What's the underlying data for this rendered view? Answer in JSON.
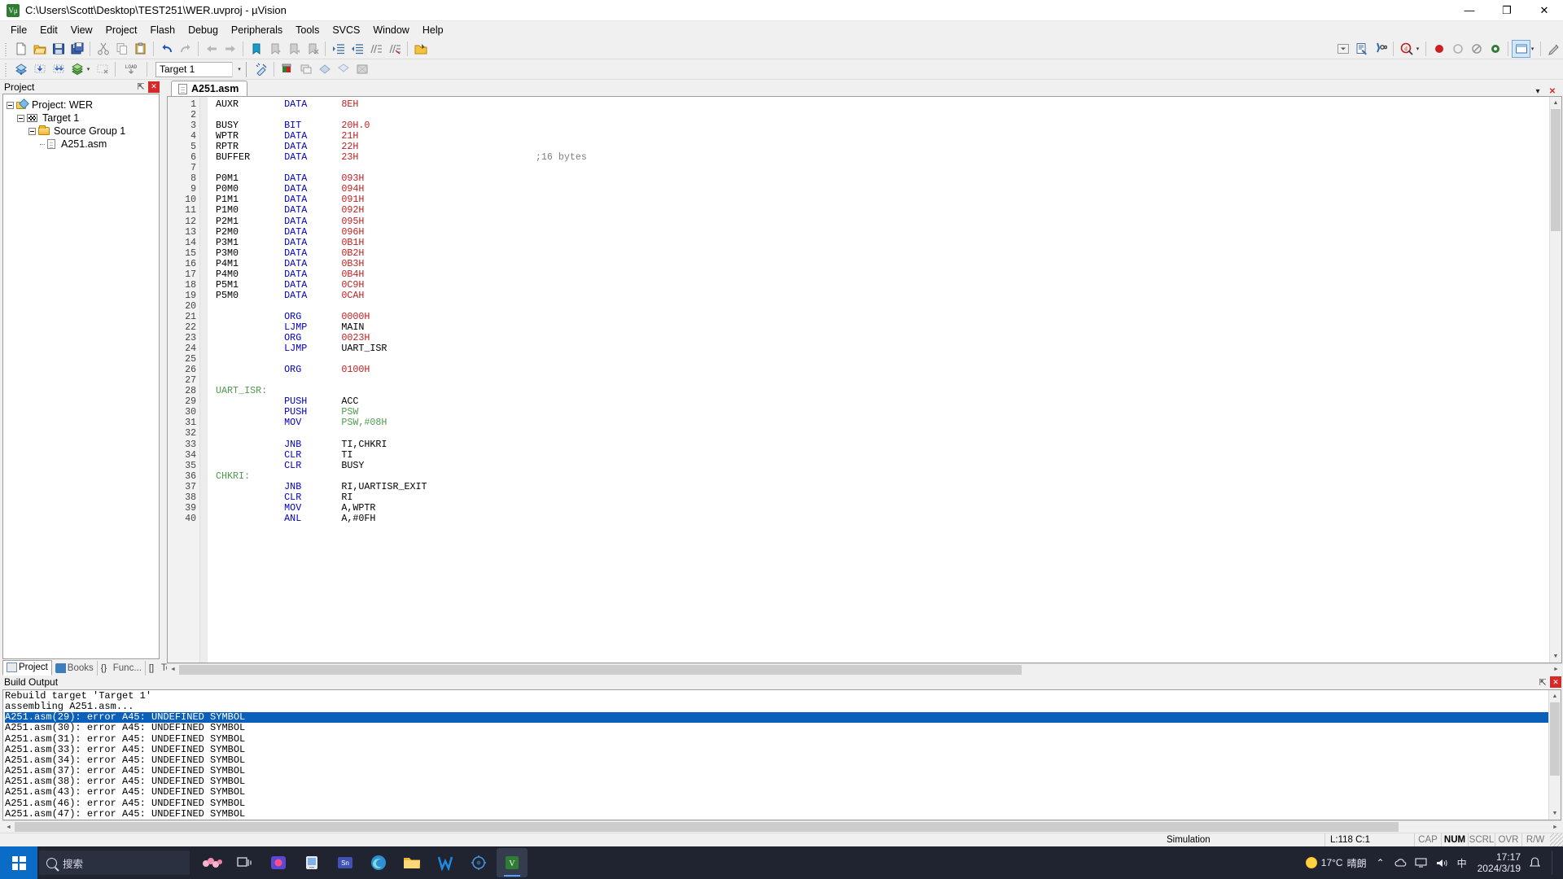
{
  "window": {
    "title": "C:\\Users\\Scott\\Desktop\\TEST251\\WER.uvproj - µVision",
    "app_icon": "uvision-icon",
    "minimize": "—",
    "maximize": "❐",
    "close": "✕"
  },
  "menu": {
    "items": [
      "File",
      "Edit",
      "View",
      "Project",
      "Flash",
      "Debug",
      "Peripherals",
      "Tools",
      "SVCS",
      "Window",
      "Help"
    ]
  },
  "toolbar_main": {
    "buttons": [
      "new-file",
      "open-file",
      "save",
      "save-all",
      "cut",
      "copy",
      "paste",
      "undo",
      "redo",
      "navigate-back",
      "navigate-forward",
      "insert-bookmark",
      "previous-bookmark",
      "next-bookmark",
      "clear-bookmarks",
      "indent",
      "outdent",
      "comment-block",
      "uncomment-block",
      "open-project-folder"
    ],
    "combo_value": "",
    "right_buttons": [
      "code-completion",
      "configure-target",
      "find-in-files"
    ],
    "debug_buttons": [
      "start-debug-session",
      "insert-breakpoint",
      "kill-breakpoints",
      "disable-breakpoint",
      "window-layout",
      "configuration-wizard"
    ],
    "zoom_dropdown": "▾"
  },
  "toolbar_build": {
    "buttons": [
      "translate",
      "build",
      "rebuild",
      "batch-build",
      "stop-build",
      "download"
    ],
    "target_label": "Target 1",
    "target_dropdown": "▾",
    "after_buttons": [
      "target-options",
      "manage-project-items",
      "manage-run-time-env",
      "remove-item",
      "multi-project"
    ]
  },
  "project_panel": {
    "caption": "Project",
    "pin": "⇱",
    "close": "✕",
    "tree": [
      {
        "label": "Project: WER",
        "icon": "project-icon",
        "level": 0,
        "expanded": true
      },
      {
        "label": "Target 1",
        "icon": "target-icon",
        "level": 1,
        "expanded": true
      },
      {
        "label": "Source Group 1",
        "icon": "folder-icon",
        "level": 2,
        "expanded": true
      },
      {
        "label": "A251.asm",
        "icon": "file-icon",
        "level": 3,
        "expanded": false
      }
    ],
    "tabs": [
      {
        "label": "Project",
        "icon": "project-tab-icon",
        "active": true
      },
      {
        "label": "Books",
        "icon": "books-tab-icon",
        "active": false
      },
      {
        "label": "Func...",
        "icon": "functions-tab-icon",
        "active": false
      },
      {
        "label": "Temp...",
        "icon": "templates-tab-icon",
        "active": false
      }
    ]
  },
  "editor": {
    "tab_label": "A251.asm",
    "tab_icon": "source-file-icon",
    "restore_icon": "▾",
    "close_icon": "✕",
    "first_line_number": 1,
    "lines": [
      {
        "n": 1,
        "tokens": [
          {
            "t": "AUXR",
            "c": "pln",
            "col": 0
          },
          {
            "t": "DATA",
            "c": "kw",
            "col": 12
          },
          {
            "t": "8EH",
            "c": "num",
            "col": 22
          }
        ]
      },
      {
        "n": 2,
        "tokens": []
      },
      {
        "n": 3,
        "tokens": [
          {
            "t": "BUSY",
            "c": "pln",
            "col": 0
          },
          {
            "t": "BIT",
            "c": "kw",
            "col": 12
          },
          {
            "t": "20H.0",
            "c": "num",
            "col": 22
          }
        ]
      },
      {
        "n": 4,
        "tokens": [
          {
            "t": "WPTR",
            "c": "pln",
            "col": 0
          },
          {
            "t": "DATA",
            "c": "kw",
            "col": 12
          },
          {
            "t": "21H",
            "c": "num",
            "col": 22
          }
        ]
      },
      {
        "n": 5,
        "tokens": [
          {
            "t": "RPTR",
            "c": "pln",
            "col": 0
          },
          {
            "t": "DATA",
            "c": "kw",
            "col": 12
          },
          {
            "t": "22H",
            "c": "num",
            "col": 22
          }
        ]
      },
      {
        "n": 6,
        "tokens": [
          {
            "t": "BUFFER",
            "c": "pln",
            "col": 0
          },
          {
            "t": "DATA",
            "c": "kw",
            "col": 12
          },
          {
            "t": "23H",
            "c": "num",
            "col": 22
          },
          {
            "t": ";16 bytes",
            "c": "cmt",
            "col": 56
          }
        ]
      },
      {
        "n": 7,
        "tokens": []
      },
      {
        "n": 8,
        "tokens": [
          {
            "t": "P0M1",
            "c": "pln",
            "col": 0
          },
          {
            "t": "DATA",
            "c": "kw",
            "col": 12
          },
          {
            "t": "093H",
            "c": "num",
            "col": 22
          }
        ]
      },
      {
        "n": 9,
        "tokens": [
          {
            "t": "P0M0",
            "c": "pln",
            "col": 0
          },
          {
            "t": "DATA",
            "c": "kw",
            "col": 12
          },
          {
            "t": "094H",
            "c": "num",
            "col": 22
          }
        ]
      },
      {
        "n": 10,
        "tokens": [
          {
            "t": "P1M1",
            "c": "pln",
            "col": 0
          },
          {
            "t": "DATA",
            "c": "kw",
            "col": 12
          },
          {
            "t": "091H",
            "c": "num",
            "col": 22
          }
        ]
      },
      {
        "n": 11,
        "tokens": [
          {
            "t": "P1M0",
            "c": "pln",
            "col": 0
          },
          {
            "t": "DATA",
            "c": "kw",
            "col": 12
          },
          {
            "t": "092H",
            "c": "num",
            "col": 22
          }
        ]
      },
      {
        "n": 12,
        "tokens": [
          {
            "t": "P2M1",
            "c": "pln",
            "col": 0
          },
          {
            "t": "DATA",
            "c": "kw",
            "col": 12
          },
          {
            "t": "095H",
            "c": "num",
            "col": 22
          }
        ]
      },
      {
        "n": 13,
        "tokens": [
          {
            "t": "P2M0",
            "c": "pln",
            "col": 0
          },
          {
            "t": "DATA",
            "c": "kw",
            "col": 12
          },
          {
            "t": "096H",
            "c": "num",
            "col": 22
          }
        ]
      },
      {
        "n": 14,
        "tokens": [
          {
            "t": "P3M1",
            "c": "pln",
            "col": 0
          },
          {
            "t": "DATA",
            "c": "kw",
            "col": 12
          },
          {
            "t": "0B1H",
            "c": "num",
            "col": 22
          }
        ]
      },
      {
        "n": 15,
        "tokens": [
          {
            "t": "P3M0",
            "c": "pln",
            "col": 0
          },
          {
            "t": "DATA",
            "c": "kw",
            "col": 12
          },
          {
            "t": "0B2H",
            "c": "num",
            "col": 22
          }
        ]
      },
      {
        "n": 16,
        "tokens": [
          {
            "t": "P4M1",
            "c": "pln",
            "col": 0
          },
          {
            "t": "DATA",
            "c": "kw",
            "col": 12
          },
          {
            "t": "0B3H",
            "c": "num",
            "col": 22
          }
        ]
      },
      {
        "n": 17,
        "tokens": [
          {
            "t": "P4M0",
            "c": "pln",
            "col": 0
          },
          {
            "t": "DATA",
            "c": "kw",
            "col": 12
          },
          {
            "t": "0B4H",
            "c": "num",
            "col": 22
          }
        ]
      },
      {
        "n": 18,
        "tokens": [
          {
            "t": "P5M1",
            "c": "pln",
            "col": 0
          },
          {
            "t": "DATA",
            "c": "kw",
            "col": 12
          },
          {
            "t": "0C9H",
            "c": "num",
            "col": 22
          }
        ]
      },
      {
        "n": 19,
        "tokens": [
          {
            "t": "P5M0",
            "c": "pln",
            "col": 0
          },
          {
            "t": "DATA",
            "c": "kw",
            "col": 12
          },
          {
            "t": "0CAH",
            "c": "num",
            "col": 22
          }
        ]
      },
      {
        "n": 20,
        "tokens": []
      },
      {
        "n": 21,
        "tokens": [
          {
            "t": "ORG",
            "c": "kw",
            "col": 12
          },
          {
            "t": "0000H",
            "c": "num",
            "col": 22
          }
        ]
      },
      {
        "n": 22,
        "tokens": [
          {
            "t": "LJMP",
            "c": "kw",
            "col": 12
          },
          {
            "t": "MAIN",
            "c": "pln",
            "col": 22
          }
        ]
      },
      {
        "n": 23,
        "tokens": [
          {
            "t": "ORG",
            "c": "kw",
            "col": 12
          },
          {
            "t": "0023H",
            "c": "num",
            "col": 22
          }
        ]
      },
      {
        "n": 24,
        "tokens": [
          {
            "t": "LJMP",
            "c": "kw",
            "col": 12
          },
          {
            "t": "UART_ISR",
            "c": "pln",
            "col": 22
          }
        ]
      },
      {
        "n": 25,
        "tokens": []
      },
      {
        "n": 26,
        "tokens": [
          {
            "t": "ORG",
            "c": "kw",
            "col": 12
          },
          {
            "t": "0100H",
            "c": "num",
            "col": 22
          }
        ]
      },
      {
        "n": 27,
        "tokens": []
      },
      {
        "n": 28,
        "tokens": [
          {
            "t": "UART_ISR:",
            "c": "lbl",
            "col": 0
          }
        ]
      },
      {
        "n": 29,
        "tokens": [
          {
            "t": "PUSH",
            "c": "kw",
            "col": 12
          },
          {
            "t": "ACC",
            "c": "pln",
            "col": 22
          }
        ]
      },
      {
        "n": 30,
        "tokens": [
          {
            "t": "PUSH",
            "c": "kw",
            "col": 12
          },
          {
            "t": "PSW",
            "c": "sfr",
            "col": 22
          }
        ]
      },
      {
        "n": 31,
        "tokens": [
          {
            "t": "MOV",
            "c": "kw",
            "col": 12
          },
          {
            "t": "PSW,#08H",
            "c": "sfr",
            "col": 22
          }
        ]
      },
      {
        "n": 32,
        "tokens": []
      },
      {
        "n": 33,
        "tokens": [
          {
            "t": "JNB",
            "c": "kw",
            "col": 12
          },
          {
            "t": "TI,CHKRI",
            "c": "pln",
            "col": 22
          }
        ]
      },
      {
        "n": 34,
        "tokens": [
          {
            "t": "CLR",
            "c": "kw",
            "col": 12
          },
          {
            "t": "TI",
            "c": "pln",
            "col": 22
          }
        ]
      },
      {
        "n": 35,
        "tokens": [
          {
            "t": "CLR",
            "c": "kw",
            "col": 12
          },
          {
            "t": "BUSY",
            "c": "pln",
            "col": 22
          }
        ]
      },
      {
        "n": 36,
        "tokens": [
          {
            "t": "CHKRI:",
            "c": "lbl",
            "col": 0
          }
        ]
      },
      {
        "n": 37,
        "tokens": [
          {
            "t": "JNB",
            "c": "kw",
            "col": 12
          },
          {
            "t": "RI,UARTISR_EXIT",
            "c": "pln",
            "col": 22
          }
        ]
      },
      {
        "n": 38,
        "tokens": [
          {
            "t": "CLR",
            "c": "kw",
            "col": 12
          },
          {
            "t": "RI",
            "c": "pln",
            "col": 22
          }
        ]
      },
      {
        "n": 39,
        "tokens": [
          {
            "t": "MOV",
            "c": "kw",
            "col": 12
          },
          {
            "t": "A,WPTR",
            "c": "pln",
            "col": 22
          }
        ]
      },
      {
        "n": 40,
        "tokens": [
          {
            "t": "ANL",
            "c": "kw",
            "col": 12
          },
          {
            "t": "A,#0FH",
            "c": "pln",
            "col": 22
          }
        ]
      }
    ]
  },
  "build_output": {
    "caption": "Build Output",
    "pin": "⇱",
    "close": "✕",
    "lines": [
      {
        "text": "Rebuild target 'Target 1'",
        "selected": false
      },
      {
        "text": "assembling A251.asm...",
        "selected": false
      },
      {
        "text": "A251.asm(29): error A45: UNDEFINED SYMBOL",
        "selected": true
      },
      {
        "text": "A251.asm(30): error A45: UNDEFINED SYMBOL",
        "selected": false
      },
      {
        "text": "A251.asm(31): error A45: UNDEFINED SYMBOL",
        "selected": false
      },
      {
        "text": "A251.asm(33): error A45: UNDEFINED SYMBOL",
        "selected": false
      },
      {
        "text": "A251.asm(34): error A45: UNDEFINED SYMBOL",
        "selected": false
      },
      {
        "text": "A251.asm(37): error A45: UNDEFINED SYMBOL",
        "selected": false
      },
      {
        "text": "A251.asm(38): error A45: UNDEFINED SYMBOL",
        "selected": false
      },
      {
        "text": "A251.asm(43): error A45: UNDEFINED SYMBOL",
        "selected": false
      },
      {
        "text": "A251.asm(46): error A45: UNDEFINED SYMBOL",
        "selected": false
      },
      {
        "text": "A251.asm(47): error A45: UNDEFINED SYMBOL",
        "selected": false
      }
    ]
  },
  "statusbar": {
    "simulation": "Simulation",
    "position": "L:118 C:1",
    "flags": [
      {
        "label": "CAP",
        "on": false
      },
      {
        "label": "NUM",
        "on": true
      },
      {
        "label": "SCRL",
        "on": false
      },
      {
        "label": "OVR",
        "on": false
      },
      {
        "label": "R/W",
        "on": false
      }
    ]
  },
  "taskbar": {
    "search_placeholder": "搜索",
    "search_icon": "search-icon",
    "start_icon": "windows-start-icon",
    "apps": [
      {
        "name": "pinned-app-sakura",
        "icon": "sakura-icon"
      },
      {
        "name": "task-view",
        "icon": "task-view-icon"
      },
      {
        "name": "pinned-app-media",
        "icon": "media-icon"
      },
      {
        "name": "pinned-app-store",
        "icon": "store-icon"
      },
      {
        "name": "pinned-app-snipaste",
        "icon": "snipaste-icon"
      },
      {
        "name": "pinned-app-edge",
        "icon": "edge-icon"
      },
      {
        "name": "pinned-app-explorer",
        "icon": "file-explorer-icon"
      },
      {
        "name": "pinned-app-wps",
        "icon": "wps-icon"
      },
      {
        "name": "pinned-app-proteus",
        "icon": "proteus-icon"
      },
      {
        "name": "running-app-uvision",
        "icon": "uvision-icon",
        "active": true
      }
    ],
    "weather_temp": "17°C",
    "weather_desc": "晴朗",
    "tray_icons": [
      "chevron-up-icon",
      "cloud-icon",
      "monitor-icon",
      "volume-icon",
      "ime-icon"
    ],
    "ime": "中",
    "clock_time": "17:17",
    "clock_date": "2024/3/19",
    "notification_icon": "notification-icon"
  }
}
